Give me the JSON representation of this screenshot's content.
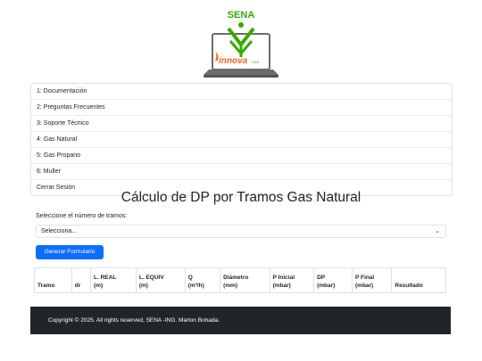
{
  "logo": {
    "brand_top": "SENA",
    "brand_bottom": "innova",
    "brand_suffix": "GAS"
  },
  "menu": {
    "items": [
      {
        "label": "1: Documentación"
      },
      {
        "label": "2: Preguntas Frecuentes"
      },
      {
        "label": "3: Soporte Técnico"
      },
      {
        "label": "4: Gas Natural"
      },
      {
        "label": "5: Gas Propano"
      },
      {
        "label": "6: Muller"
      },
      {
        "label": "Cerrar Sesión"
      }
    ]
  },
  "main": {
    "title": "Cálculo de DP por Tramos Gas Natural",
    "select_label": "Seleccione el número de tramos:",
    "select_value": "Selecciona...",
    "generate_button": "Generar Formulario",
    "table_headers": [
      {
        "line1": "",
        "line2": "Tramo"
      },
      {
        "line1": "",
        "line2": "dr"
      },
      {
        "line1": "L. REAL",
        "line2": "(m)"
      },
      {
        "line1": "L. EQUIV",
        "line2": "(m)"
      },
      {
        "line1": "Q",
        "line2": "(m³/h)"
      },
      {
        "line1": "Diámetro",
        "line2": "(mm)"
      },
      {
        "line1": "P Inicial",
        "line2": "(mbar)"
      },
      {
        "line1": "DP",
        "line2": "(mbar)"
      },
      {
        "line1": "P Final",
        "line2": "(mbar)"
      },
      {
        "line1": "",
        "line2": "Resultado"
      }
    ]
  },
  "footer": {
    "text": "Copyright © 2025. All rights reserved, SENA -ING. Marlon Bohada."
  },
  "colors": {
    "primary": "#0d6efd",
    "sena_green": "#39a900",
    "innova_orange": "#f26522",
    "footer_bg": "#212529"
  }
}
